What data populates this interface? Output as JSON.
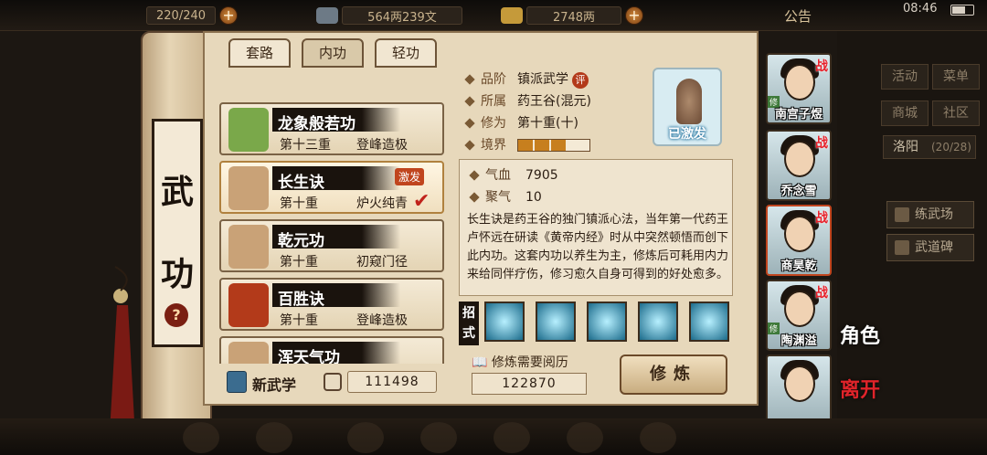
{
  "topbar": {
    "stamina": "220/240",
    "money_silver": "564两239文",
    "money_gold": "2748两",
    "notice": "公告",
    "clock": "08:46"
  },
  "scroll": {
    "title_top": "武",
    "title_bottom": "功",
    "help": "?"
  },
  "tabs": [
    {
      "label": "套路"
    },
    {
      "label": "内功"
    },
    {
      "label": "轻功"
    }
  ],
  "skills": [
    {
      "name": "龙象般若功",
      "level": "第十三重",
      "stage": "登峰造极",
      "icon_color": "#7aa84a"
    },
    {
      "name": "长生诀",
      "level": "第十重",
      "stage": "炉火纯青",
      "badge": "激发",
      "selected": true,
      "icon_color": "#c9a277"
    },
    {
      "name": "乾元功",
      "level": "第十重",
      "stage": "初窥门径",
      "icon_color": "#c9a277"
    },
    {
      "name": "百胜诀",
      "level": "第十重",
      "stage": "登峰造极",
      "icon_color": "#b33a1a"
    },
    {
      "name": "浑天气功",
      "level": "",
      "stage": "",
      "icon_color": "#c9a277"
    }
  ],
  "new_skill": {
    "label": "新武学",
    "count": "111498"
  },
  "detail": {
    "grade_label": "品阶",
    "grade": "镇派武学",
    "grade_badge": "评",
    "faction_label": "所属",
    "faction": "药王谷(混元)",
    "cultivation_label": "修为",
    "cultivation": "第十重(十)",
    "realm_label": "境界",
    "realm_filled": 3,
    "realm_total": 4,
    "portrait_label": "已激发"
  },
  "stats": {
    "hp_label": "气血",
    "hp": "7905",
    "qi_label": "聚气",
    "qi": "10",
    "description": "长生诀是药王谷的独门镇派心法，当年第一代药王卢怀远在研读《黄帝内经》时从中突然顿悟而创下此内功。这套内功以养生为主，修炼后可耗用内力来给同伴疗伤，修习愈久自身可得到的好处愈多。"
  },
  "moves": {
    "label": "招式",
    "count": 5
  },
  "requirement": {
    "label": "修炼需要阅历",
    "value": "122870"
  },
  "train_button": "修炼",
  "characters": [
    {
      "name": "南宫子煜",
      "tag": "修",
      "war": "战"
    },
    {
      "name": "乔念雪",
      "tag": "",
      "war": "战"
    },
    {
      "name": "商昊乾",
      "tag": "",
      "war": "战"
    },
    {
      "name": "陶渊溢",
      "tag": "修",
      "war": "战"
    },
    {
      "name": "",
      "tag": "",
      "war": ""
    }
  ],
  "side_menu": {
    "activity": "活动",
    "menu": "菜单",
    "shop": "商城",
    "community": "社区",
    "city": "洛阳",
    "city_count": "(20/28)",
    "practice": "练武场",
    "stele": "武道碑",
    "role": "角色",
    "leave": "离开"
  }
}
